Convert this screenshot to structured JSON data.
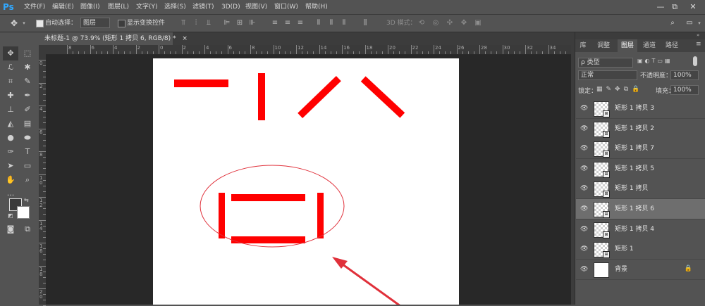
{
  "app": {
    "logo": "Ps",
    "menu": [
      "文件(F)",
      "编辑(E)",
      "图像(I)",
      "图层(L)",
      "文字(Y)",
      "选择(S)",
      "滤镜(T)",
      "3D(D)",
      "视图(V)",
      "窗口(W)",
      "帮助(H)"
    ],
    "window_controls": [
      "—",
      "⧉",
      "✕"
    ]
  },
  "options": {
    "auto_select_label": "自动选择：",
    "auto_select_value": "图层",
    "show_transform_label": "显示变换控件",
    "mode_3d_label": "3D 模式："
  },
  "document": {
    "tab_title": "未标题-1 @ 73.9% (矩形 1 拷贝 6, RGB/8) *",
    "tab_close": "×",
    "ruler_top_labels": [
      "8",
      "6",
      "4",
      "2",
      "0",
      "2",
      "4",
      "6",
      "8",
      "10",
      "12",
      "14",
      "16",
      "18",
      "20",
      "22",
      "24",
      "26",
      "28",
      "30",
      "32",
      "34"
    ],
    "ruler_left_labels": [
      "0",
      "2",
      "4",
      "6",
      "8",
      "1\n0",
      "1\n2",
      "1\n4",
      "1\n6",
      "1\n8",
      "2\n0"
    ]
  },
  "panel": {
    "tabs": [
      "库",
      "调整",
      "图层",
      "通道",
      "路径"
    ],
    "active_tab": "图层",
    "filter_kind": "ρ 类型",
    "blend_mode": "正常",
    "opacity_label": "不透明度：",
    "opacity_value": "100%",
    "lock_label": "锁定：",
    "fill_label": "填充：",
    "fill_value": "100%",
    "layers": [
      {
        "name": "矩形 1 拷贝 3",
        "selected": false
      },
      {
        "name": "矩形 1 拷贝 2",
        "selected": false
      },
      {
        "name": "矩形 1 拷贝 7",
        "selected": false
      },
      {
        "name": "矩形 1 拷贝 5",
        "selected": false
      },
      {
        "name": "矩形 1 拷贝",
        "selected": false
      },
      {
        "name": "矩形 1 拷贝 6",
        "selected": true
      },
      {
        "name": "矩形 1 拷贝 4",
        "selected": false
      },
      {
        "name": "矩形 1",
        "selected": false
      },
      {
        "name": "背景",
        "selected": false,
        "background": true
      }
    ]
  },
  "colors": {
    "shape_red": "#ff0000",
    "annotation_red": "#e0303a",
    "ui_gray": "#535353",
    "workspace": "#282828"
  }
}
